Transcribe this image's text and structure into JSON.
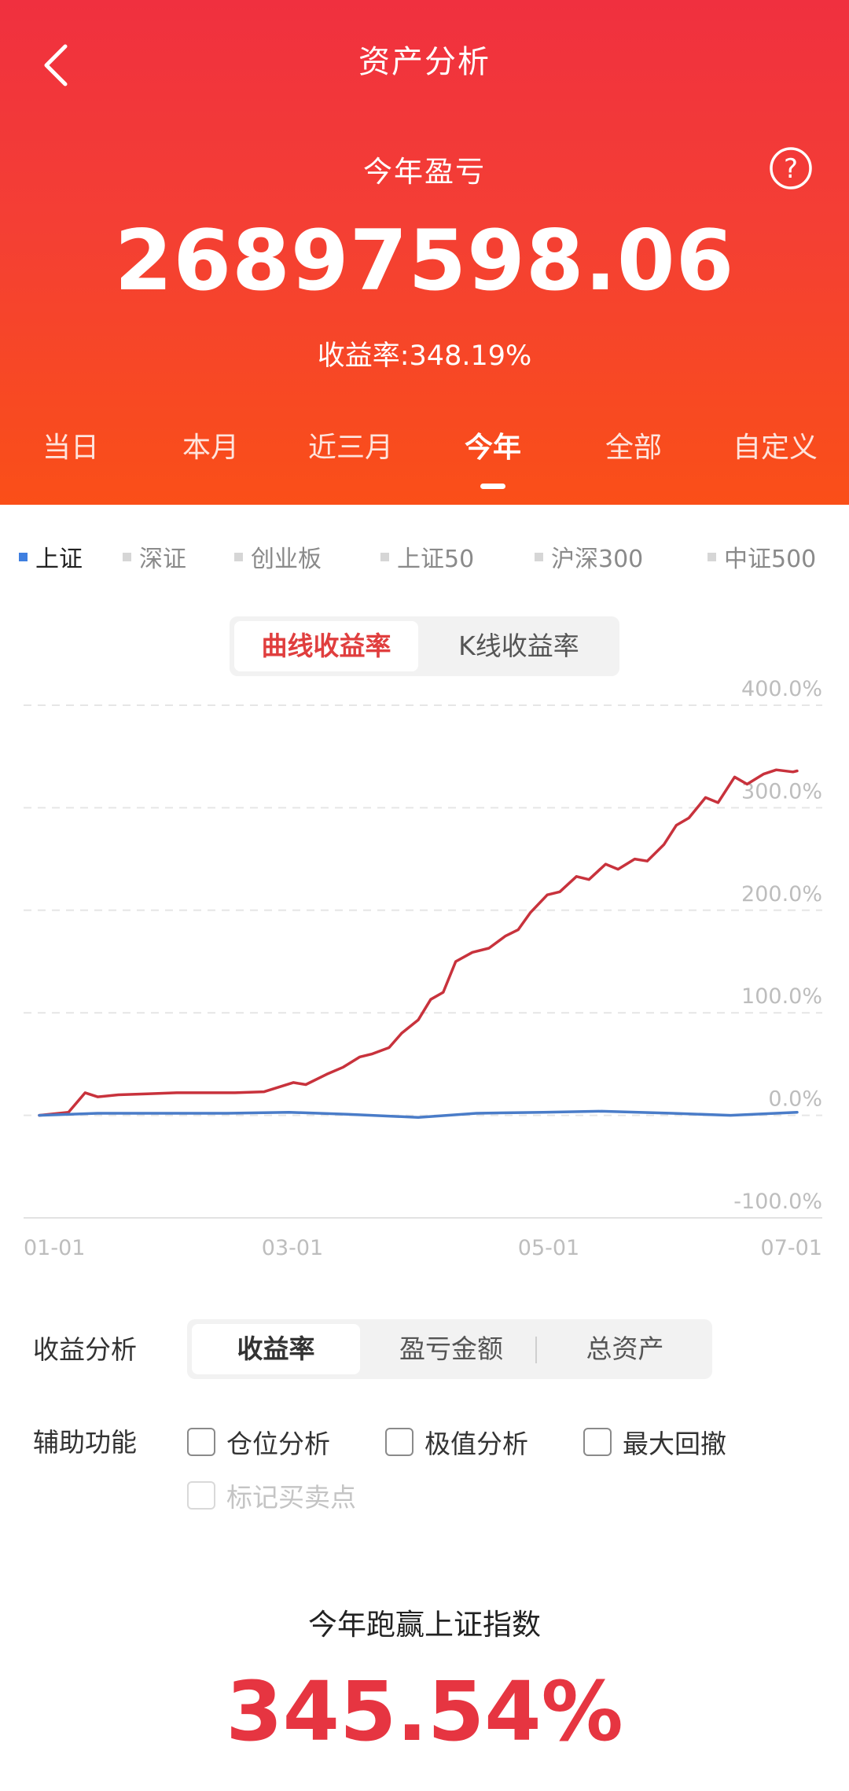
{
  "header": {
    "title": "资产分析",
    "period_label": "今年盈亏",
    "profit_value": "26897598.06",
    "yield_label": "收益率:",
    "yield_value": "348.19%"
  },
  "tabs": [
    "当日",
    "本月",
    "近三月",
    "今年",
    "全部",
    "自定义"
  ],
  "active_tab": "今年",
  "index_selector": [
    "上证",
    "深证",
    "创业板",
    "上证50",
    "沪深300",
    "中证500"
  ],
  "active_index": "上证",
  "chart_mode": {
    "options": [
      "曲线收益率",
      "K线收益率"
    ],
    "active": "曲线收益率"
  },
  "chart_data": {
    "type": "line",
    "x_tick_labels": [
      "01-01",
      "03-01",
      "05-01",
      "07-01"
    ],
    "y_tick_labels": [
      "400.0%",
      "300.0%",
      "200.0%",
      "100.0%",
      "0.0%",
      "-100.0%"
    ],
    "ylim": [
      -100,
      400
    ],
    "grid": true,
    "series": [
      {
        "color": "#c8323c",
        "x": [
          "01-01",
          "01-08",
          "01-12",
          "01-15",
          "01-20",
          "01-27",
          "02-03",
          "02-10",
          "02-17",
          "02-24",
          "03-02",
          "03-05",
          "03-10",
          "03-14",
          "03-18",
          "03-21",
          "03-25",
          "03-28",
          "04-01",
          "04-04",
          "04-07",
          "04-10",
          "04-14",
          "04-18",
          "04-22",
          "04-25",
          "04-28",
          "05-02",
          "05-05",
          "05-09",
          "05-12",
          "05-16",
          "05-19",
          "05-23",
          "05-26",
          "05-30",
          "06-02",
          "06-05",
          "06-09",
          "06-12",
          "06-16",
          "06-19",
          "06-23",
          "06-26",
          "06-30",
          "07-01"
        ],
        "values": [
          0,
          3,
          22,
          18,
          20,
          21,
          22,
          22,
          22,
          23,
          32,
          30,
          40,
          47,
          57,
          60,
          66,
          80,
          93,
          113,
          120,
          150,
          159,
          163,
          175,
          181,
          198,
          215,
          218,
          233,
          230,
          245,
          240,
          250,
          248,
          264,
          283,
          290,
          310,
          305,
          330,
          323,
          333,
          337,
          335,
          336
        ]
      },
      {
        "color": "#4a7cc8",
        "x": [
          "01-01",
          "01-15",
          "02-01",
          "02-15",
          "03-01",
          "03-15",
          "04-01",
          "04-15",
          "05-01",
          "05-15",
          "06-01",
          "06-15",
          "07-01"
        ],
        "values": [
          0,
          2,
          2,
          2,
          3,
          1,
          -2,
          2,
          3,
          4,
          2,
          0,
          3
        ]
      }
    ]
  },
  "profit_analysis": {
    "label": "收益分析",
    "options": [
      "收益率",
      "盈亏金额",
      "总资产"
    ],
    "active": "收益率"
  },
  "aux": {
    "label": "辅助功能",
    "options": [
      "仓位分析",
      "极值分析",
      "最大回撤",
      "标记买卖点"
    ]
  },
  "summary": {
    "label": "今年跑赢上证指数",
    "value": "345.54%"
  }
}
